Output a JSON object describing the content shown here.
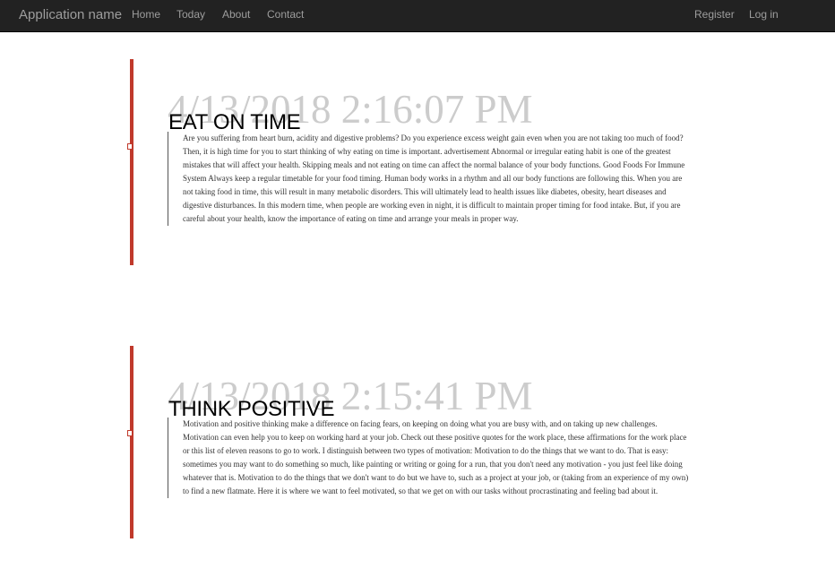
{
  "navbar": {
    "brand": "Application name",
    "links": [
      "Home",
      "Today",
      "About",
      "Contact"
    ],
    "right_links": [
      "Register",
      "Log in"
    ]
  },
  "entries": [
    {
      "timestamp": "4/13/2018 2:16:07 PM",
      "title": "EAT ON TIME",
      "body": "Are you suffering from heart burn, acidity and digestive problems? Do you experience excess weight gain even when you are not taking too much of food? Then, it is high time for you to start thinking of why eating on time is important. advertisement Abnormal or irregular eating habit is one of the greatest mistakes that will affect your health. Skipping meals and not eating on time can affect the normal balance of your body functions. Good Foods For Immune System Always keep a regular timetable for your food timing. Human body works in a rhythm and all our body functions are following this. When you are not taking food in time, this will result in many metabolic disorders. This will ultimately lead to health issues like diabetes, obesity, heart diseases and digestive disturbances. In this modern time, when people are working even in night, it is difficult to maintain proper timing for food intake. But, if you are careful about your health, know the importance of eating on time and arrange your meals in proper way."
    },
    {
      "timestamp": "4/13/2018 2:15:41 PM",
      "title": "THINK POSITIVE",
      "body": "Motivation and positive thinking make a difference on facing fears, on keeping on doing what you are busy with, and on taking up new challenges. Motivation can even help you to keep on working hard at your job. Check out these positive quotes for the work place, these affirmations for the work place or this list of eleven reasons to go to work. I distinguish between two types of motivation: Motivation to do the things that we want to do. That is easy: sometimes you may want to do something so much, like painting or writing or going for a run, that you don't need any motivation - you just feel like doing whatever that is. Motivation to do the things that we don't want to do but we have to, such as a project at your job, or (taking from an experience of my own) to find a new flatmate. Here it is where we want to feel motivated, so that we get on with our tasks without procrastinating and feeling bad about it."
    }
  ],
  "colors": {
    "navbar_bg": "#222222",
    "nav_text": "#9d9d9d",
    "timeline_accent": "#c0392b",
    "timestamp_text": "#cccccc"
  }
}
